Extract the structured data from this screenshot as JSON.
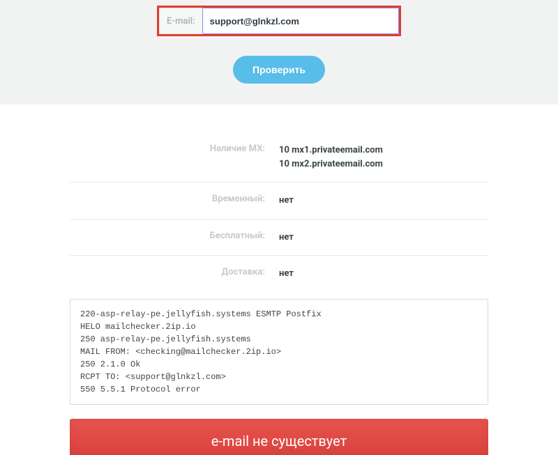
{
  "form": {
    "email_label": "E-mail:",
    "email_value": "support@glnkzl.com",
    "check_button": "Проверить"
  },
  "results": {
    "mx": {
      "label": "Наличие MX:",
      "records": [
        "10 mx1.privateemail.com",
        "10 mx2.privateemail.com"
      ]
    },
    "temporary": {
      "label": "Временный:",
      "value": "нет"
    },
    "free": {
      "label": "Бесплатный:",
      "value": "нет"
    },
    "delivery": {
      "label": "Доставка:",
      "value": "нет"
    }
  },
  "smtp_log": "220-asp-relay-pe.jellyfish.systems ESMTP Postfix\nHELO mailchecker.2ip.io\n250 asp-relay-pe.jellyfish.systems\nMAIL FROM: <checking@mailchecker.2ip.io>\n250 2.1.0 Ok\nRCPT TO: <support@glnkzl.com>\n550 5.5.1 Protocol error",
  "verdict": "e-mail не существует"
}
